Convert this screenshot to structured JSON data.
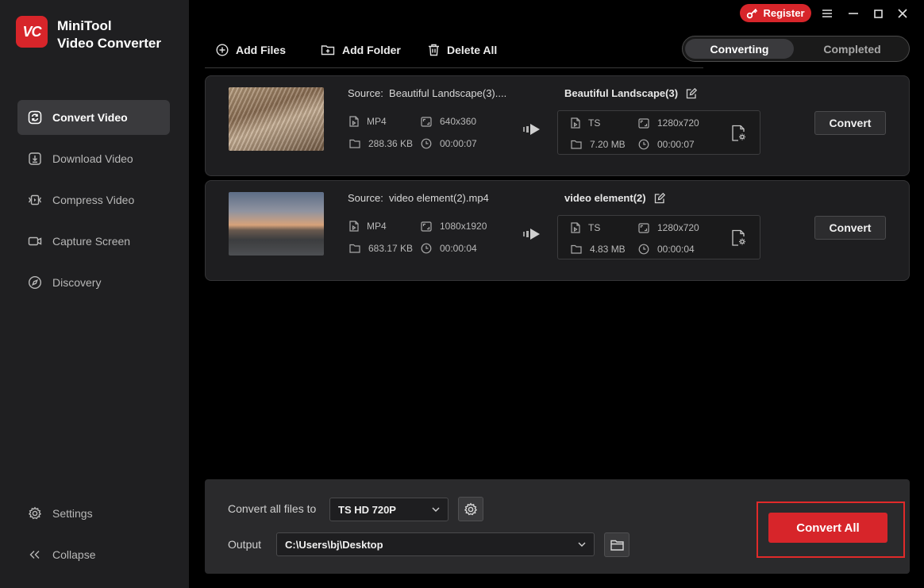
{
  "app": {
    "logo_text": "VC",
    "title_line1": "MiniTool",
    "title_line2": "Video Converter"
  },
  "window": {
    "register_label": "Register"
  },
  "sidebar": {
    "items": [
      {
        "label": "Convert Video",
        "icon": "convert-icon",
        "active": true
      },
      {
        "label": "Download Video",
        "icon": "download-icon"
      },
      {
        "label": "Compress Video",
        "icon": "compress-icon"
      },
      {
        "label": "Capture Screen",
        "icon": "camera-icon"
      },
      {
        "label": "Discovery",
        "icon": "compass-icon"
      }
    ],
    "settings_label": "Settings",
    "collapse_label": "Collapse"
  },
  "toolbar": {
    "add_files": "Add Files",
    "add_folder": "Add Folder",
    "delete_all": "Delete All"
  },
  "tabs": {
    "converting": "Converting",
    "completed": "Completed"
  },
  "files": [
    {
      "source_prefix": "Source:",
      "source_name": "Beautiful Landscape(3)....",
      "src_format": "MP4",
      "src_resolution": "640x360",
      "src_size": "288.36 KB",
      "src_duration": "00:00:07",
      "target_name": "Beautiful Landscape(3)",
      "tgt_format": "TS",
      "tgt_resolution": "1280x720",
      "tgt_size": "7.20 MB",
      "tgt_duration": "00:00:07",
      "convert_label": "Convert"
    },
    {
      "source_prefix": "Source:",
      "source_name": "video element(2).mp4",
      "src_format": "MP4",
      "src_resolution": "1080x1920",
      "src_size": "683.17 KB",
      "src_duration": "00:00:04",
      "target_name": "video element(2)",
      "tgt_format": "TS",
      "tgt_resolution": "1280x720",
      "tgt_size": "4.83 MB",
      "tgt_duration": "00:00:04",
      "convert_label": "Convert"
    }
  ],
  "bottom": {
    "convert_all_to_label": "Convert all files to",
    "format_value": "TS HD 720P",
    "output_label": "Output",
    "output_path": "C:\\Users\\bj\\Desktop",
    "convert_all_label": "Convert All"
  },
  "colors": {
    "accent": "#d7252a",
    "sidebar_bg": "#1f1f21",
    "card_bg": "#1e1e20",
    "panel_bg": "#2a2a2c"
  }
}
